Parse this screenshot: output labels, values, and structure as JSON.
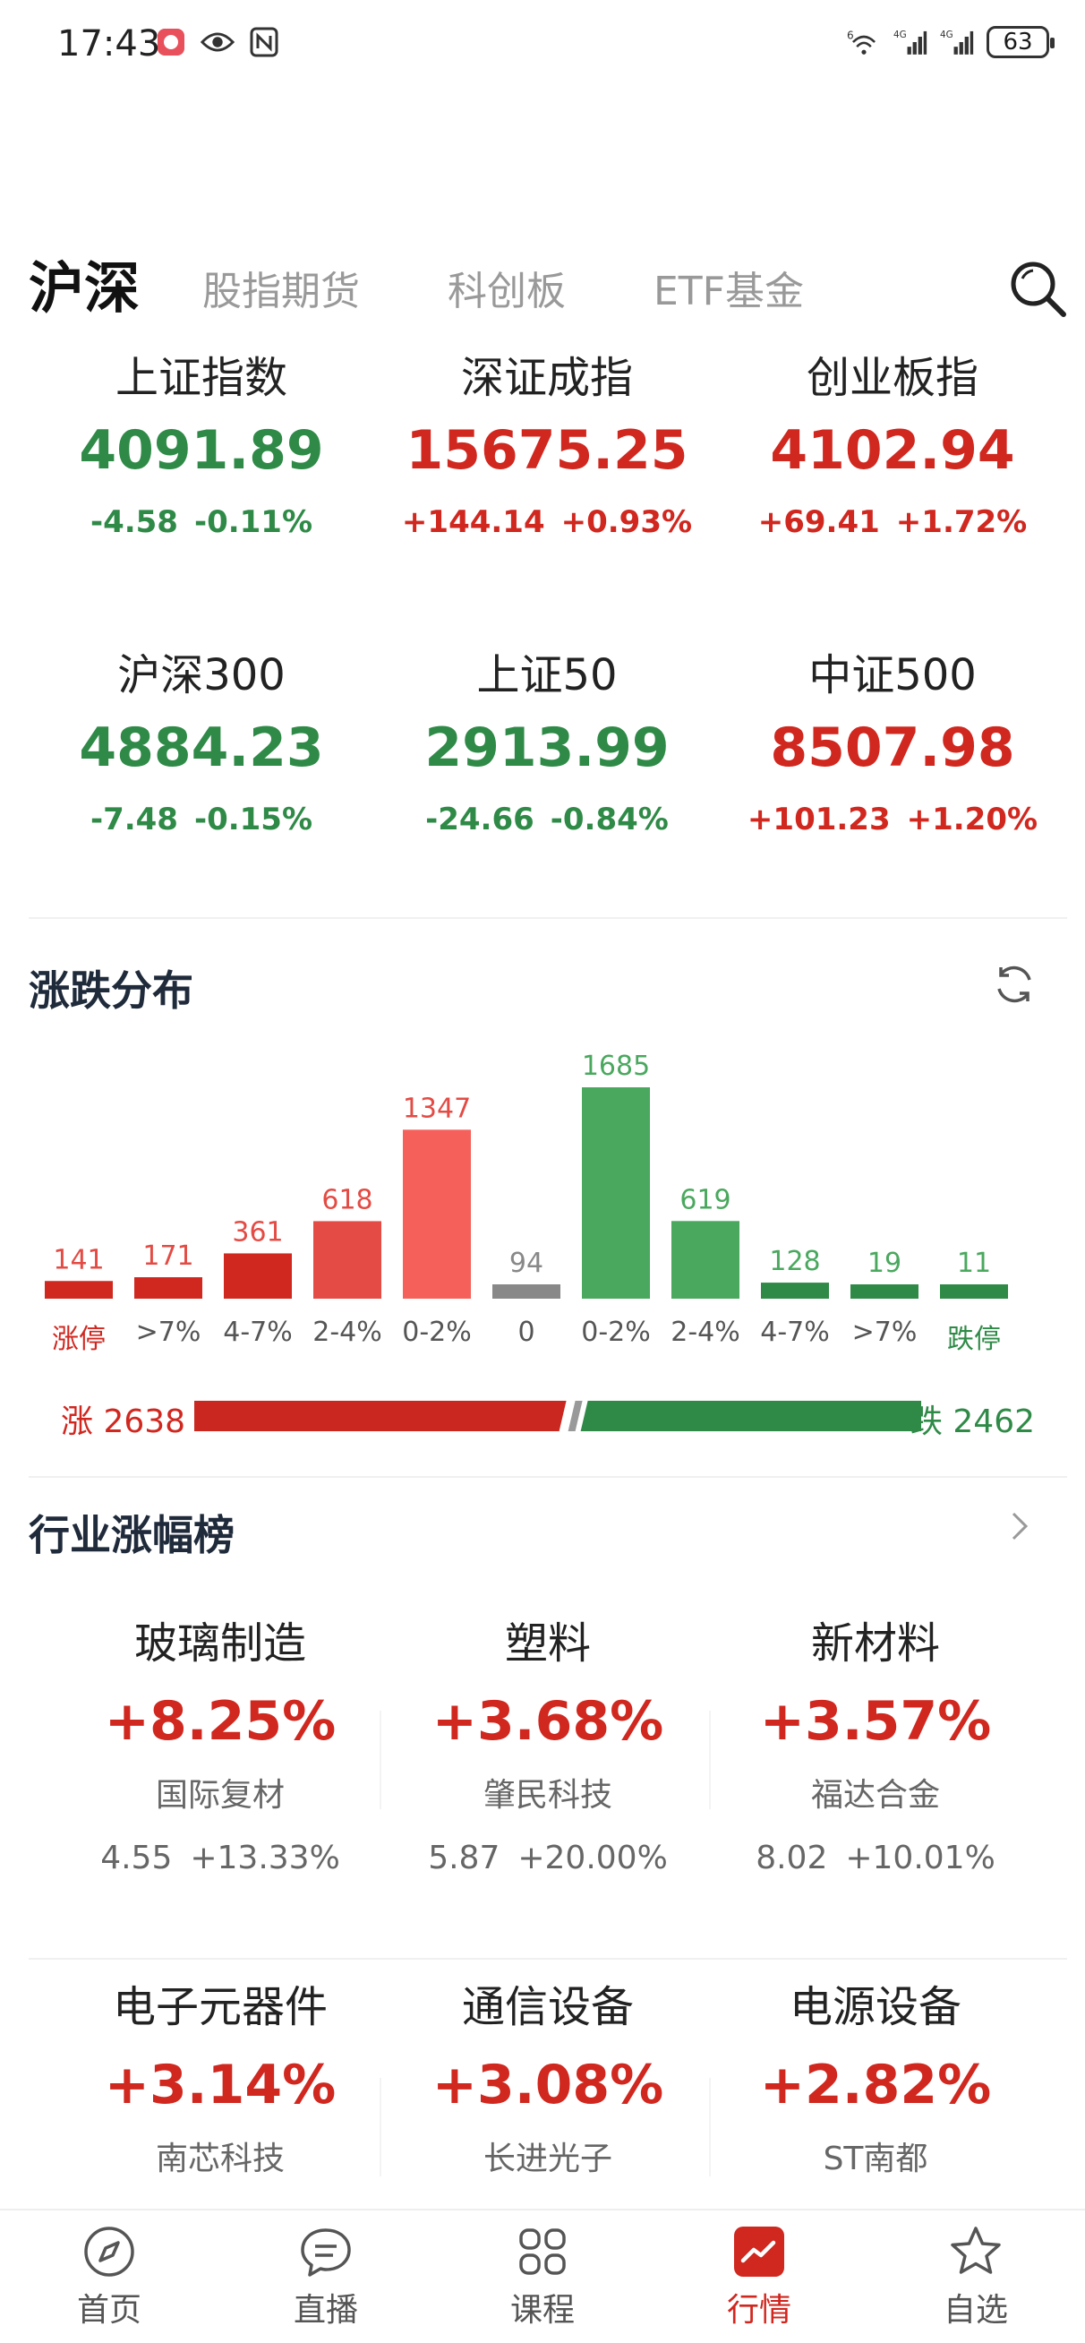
{
  "status_bar": {
    "time": "17:43",
    "battery": "63",
    "signal_1": "4G",
    "signal_2": "4G",
    "wifi_badge": "6"
  },
  "tabs": [
    {
      "label": "沪深",
      "active": true
    },
    {
      "label": "股指期货",
      "active": false
    },
    {
      "label": "科创板",
      "active": false
    },
    {
      "label": "ETF基金",
      "active": false
    }
  ],
  "indices": [
    {
      "name": "上证指数",
      "value": "4091.89",
      "change": "-4.58",
      "pct": "-0.11%",
      "dir": "down"
    },
    {
      "name": "深证成指",
      "value": "15675.25",
      "change": "+144.14",
      "pct": "+0.93%",
      "dir": "up"
    },
    {
      "name": "创业板指",
      "value": "4102.94",
      "change": "+69.41",
      "pct": "+1.72%",
      "dir": "up"
    },
    {
      "name": "沪深300",
      "value": "4884.23",
      "change": "-7.48",
      "pct": "-0.15%",
      "dir": "down"
    },
    {
      "name": "上证50",
      "value": "2913.99",
      "change": "-24.66",
      "pct": "-0.84%",
      "dir": "down"
    },
    {
      "name": "中证500",
      "value": "8507.98",
      "change": "+101.23",
      "pct": "+1.20%",
      "dir": "up"
    }
  ],
  "distribution": {
    "title": "涨跌分布",
    "up_label": "涨 2638",
    "down_label": "跌 2462",
    "up_total": 2638,
    "down_total": 2462,
    "colors": {
      "up_strong": "#d0271f",
      "up_mid": "#e34b44",
      "up_light": "#f5615a",
      "flat": "#888888",
      "down_light": "#4aa85e",
      "down_strong": "#2f8a47",
      "ratio_up": "#c9271f",
      "ratio_down": "#2f8a47"
    }
  },
  "chart_data": {
    "type": "bar",
    "categories": [
      "涨停",
      ">7%",
      "4-7%",
      "2-4%",
      "0-2%",
      "0",
      "0-2%",
      "2-4%",
      "4-7%",
      ">7%",
      "跌停"
    ],
    "values": [
      141,
      171,
      361,
      618,
      1347,
      94,
      1685,
      619,
      128,
      19,
      11
    ],
    "title": "涨跌分布",
    "xlabel": "",
    "ylabel": "",
    "ylim": [
      0,
      1685
    ]
  },
  "industry": {
    "title": "行业涨幅榜",
    "items": [
      {
        "name": "玻璃制造",
        "pct": "+8.25%",
        "stock": "国际复材",
        "price": "4.55",
        "stock_pct": "+13.33%"
      },
      {
        "name": "塑料",
        "pct": "+3.68%",
        "stock": "肇民科技",
        "price": "5.87",
        "stock_pct": "+20.00%"
      },
      {
        "name": "新材料",
        "pct": "+3.57%",
        "stock": "福达合金",
        "price": "8.02",
        "stock_pct": "+10.01%"
      },
      {
        "name": "电子元器件",
        "pct": "+3.14%",
        "stock": "南芯科技",
        "price": "",
        "stock_pct": ""
      },
      {
        "name": "通信设备",
        "pct": "+3.08%",
        "stock": "长进光子",
        "price": "",
        "stock_pct": ""
      },
      {
        "name": "电源设备",
        "pct": "+2.82%",
        "stock": "ST南都",
        "price": "",
        "stock_pct": ""
      }
    ]
  },
  "bottom_nav": [
    {
      "label": "首页",
      "icon": "compass-icon",
      "active": false
    },
    {
      "label": "直播",
      "icon": "chat-bubble-icon",
      "active": false
    },
    {
      "label": "课程",
      "icon": "grid-icon",
      "active": false
    },
    {
      "label": "行情",
      "icon": "trend-chart-icon",
      "active": true
    },
    {
      "label": "自选",
      "icon": "star-icon",
      "active": false
    }
  ]
}
